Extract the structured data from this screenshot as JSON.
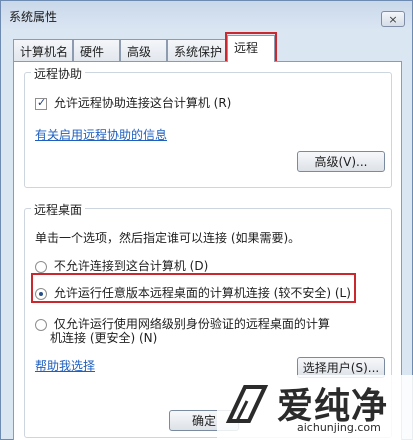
{
  "window": {
    "title": "系统属性",
    "close_icon": "×"
  },
  "tabs": [
    {
      "label": "计算机名"
    },
    {
      "label": "硬件"
    },
    {
      "label": "高级"
    },
    {
      "label": "系统保护"
    },
    {
      "label": "远程",
      "active": true
    }
  ],
  "remote_assistance": {
    "group_title": "远程协助",
    "allow_label": "允许远程协助连接这台计算机 (R)",
    "allow_checked": true,
    "info_link": "有关启用远程协助的信息",
    "advanced_button": "高级(V)..."
  },
  "remote_desktop": {
    "group_title": "远程桌面",
    "instruction": "单击一个选项，然后指定谁可以连接 (如果需要)。",
    "options": [
      {
        "label": "不允许连接到这台计算机 (D)",
        "checked": false
      },
      {
        "label": "允许运行任意版本远程桌面的计算机连接 (较不安全) (L)",
        "checked": true
      },
      {
        "label": "仅允许运行使用网络级别身份验证的远程桌面的计算",
        "label2": "机连接 (更安全) (N)",
        "checked": false
      }
    ],
    "help_link": "帮助我选择",
    "select_users_button": "选择用户(S)..."
  },
  "footer": {
    "ok_button": "确定"
  },
  "watermark": {
    "brand": "爱纯净",
    "url": "aichunjing.com"
  },
  "colors": {
    "highlight": "#c8282e",
    "link": "#1f5fbf"
  }
}
